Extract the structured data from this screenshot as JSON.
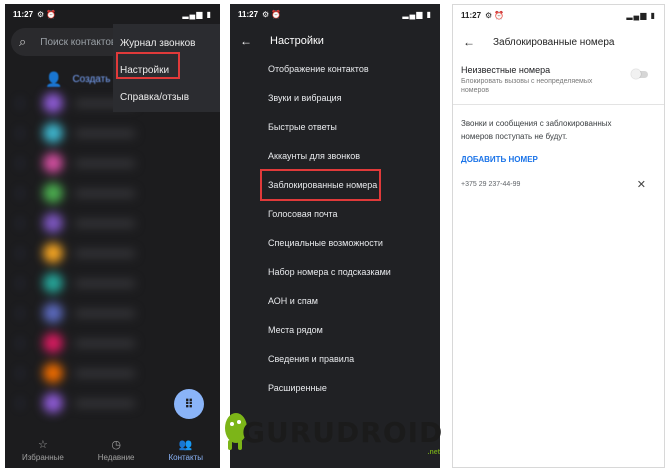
{
  "panel1": {
    "status": {
      "time": "11:27"
    },
    "search_placeholder": "Поиск контактов",
    "create_label": "Создать",
    "menu": [
      "Журнал звонков",
      "Настройки",
      "Справка/отзыв"
    ],
    "nav": [
      {
        "label": "Избранные",
        "icon": "star-icon"
      },
      {
        "label": "Недавние",
        "icon": "clock-icon"
      },
      {
        "label": "Контакты",
        "icon": "people-icon"
      }
    ],
    "colors": {
      "accent": "#8ab4f8",
      "highlight": "#e03a3a"
    }
  },
  "panel2": {
    "status": {
      "time": "11:27"
    },
    "title": "Настройки",
    "items": [
      "Отображение контактов",
      "Звуки и вибрация",
      "Быстрые ответы",
      "Аккаунты для звонков",
      "Заблокированные номера",
      "Голосовая почта",
      "Специальные возможности",
      "Набор номера с подсказками",
      "АОН и спам",
      "Места рядом",
      "Сведения и правила",
      "Расширенные"
    ]
  },
  "panel3": {
    "status": {
      "time": "11:27"
    },
    "title": "Заблокированные номера",
    "unknown_title": "Неизвестные номера",
    "unknown_sub": "Блокировать вызовы с неопределяемых номеров",
    "unknown_enabled": false,
    "info": "Звонки и сообщения с заблокированных номеров поступать не будут.",
    "add_number": "ДОБАВИТЬ НОМЕР",
    "blocked_number": "+375 29 237-44-99"
  },
  "logo": {
    "text": "GURUDROID",
    "suffix": ".net"
  }
}
